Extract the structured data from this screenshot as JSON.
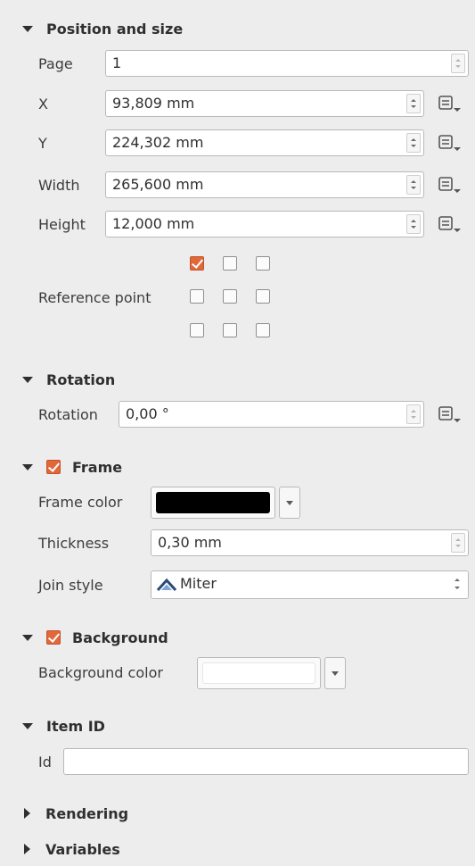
{
  "sections": {
    "position": {
      "title": "Position and size",
      "page": {
        "label": "Page",
        "value": "1"
      },
      "x": {
        "label": "X",
        "value": "93,809 mm"
      },
      "y": {
        "label": "Y",
        "value": "224,302 mm"
      },
      "width": {
        "label": "Width",
        "value": "265,600 mm"
      },
      "height": {
        "label": "Height",
        "value": "12,000 mm"
      },
      "reference_point": {
        "label": "Reference point",
        "checked": [
          true,
          false,
          false,
          false,
          false,
          false,
          false,
          false,
          false
        ]
      }
    },
    "rotation": {
      "title": "Rotation",
      "label": "Rotation",
      "value": "0,00 °"
    },
    "frame": {
      "title": "Frame",
      "enabled": true,
      "color_label": "Frame color",
      "color": "#000000",
      "thickness_label": "Thickness",
      "thickness": "0,30 mm",
      "join_label": "Join style",
      "join_value": "Miter"
    },
    "background": {
      "title": "Background",
      "enabled": true,
      "color_label": "Background color",
      "color": "#ffffff"
    },
    "item_id": {
      "title": "Item ID",
      "label": "Id",
      "value": ""
    },
    "rendering": {
      "title": "Rendering"
    },
    "variables": {
      "title": "Variables"
    }
  },
  "icons": {
    "data_defined": "data-defined-override-icon",
    "expanded": "triangle-down-icon",
    "collapsed": "triangle-right-icon",
    "join": "miter-join-icon"
  },
  "colors": {
    "accent": "#e0683b",
    "panel_bg": "#ededed"
  }
}
